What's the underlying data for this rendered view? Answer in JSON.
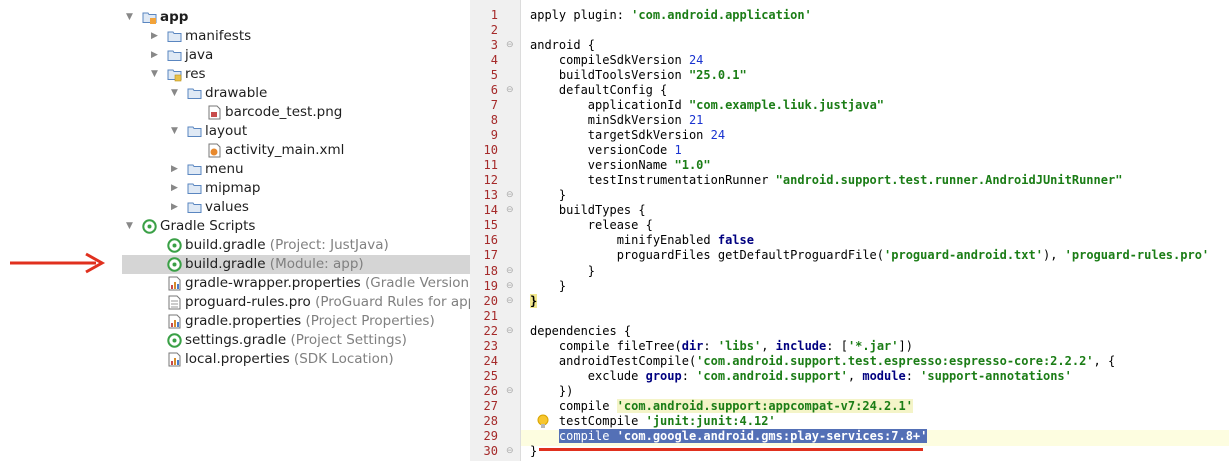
{
  "tree": [
    {
      "label": "app",
      "hint": "",
      "bold": true,
      "icon": "module-folder-icon",
      "twisty": "down",
      "indent": 0
    },
    {
      "label": "manifests",
      "hint": "",
      "icon": "folder-icon",
      "twisty": "right",
      "indent": 1
    },
    {
      "label": "java",
      "hint": "",
      "icon": "folder-icon",
      "twisty": "right",
      "indent": 1
    },
    {
      "label": "res",
      "hint": "",
      "icon": "res-folder-icon",
      "twisty": "down",
      "indent": 1
    },
    {
      "label": "drawable",
      "hint": "",
      "icon": "folder-icon",
      "twisty": "down",
      "indent": 2
    },
    {
      "label": "barcode_test.png",
      "hint": "",
      "icon": "image-file-icon",
      "twisty": "",
      "indent": 4
    },
    {
      "label": "layout",
      "hint": "",
      "icon": "folder-icon",
      "twisty": "down",
      "indent": 2
    },
    {
      "label": "activity_main.xml",
      "hint": "",
      "icon": "xml-file-icon",
      "twisty": "",
      "indent": 4
    },
    {
      "label": "menu",
      "hint": "",
      "icon": "folder-icon",
      "twisty": "right",
      "indent": 2
    },
    {
      "label": "mipmap",
      "hint": "",
      "icon": "folder-icon",
      "twisty": "right",
      "indent": 2
    },
    {
      "label": "values",
      "hint": "",
      "icon": "folder-icon",
      "twisty": "right",
      "indent": 2
    },
    {
      "label": "Gradle Scripts",
      "hint": "",
      "icon": "gradle-icon",
      "twisty": "down",
      "indent": 0
    },
    {
      "label": "build.gradle",
      "hint": " (Project: JustJava)",
      "icon": "gradle-icon",
      "twisty": "",
      "indent": 1
    },
    {
      "label": "build.gradle",
      "hint": " (Module: app)",
      "icon": "gradle-icon",
      "twisty": "",
      "indent": 1,
      "selected": true
    },
    {
      "label": "gradle-wrapper.properties",
      "hint": " (Gradle Version)",
      "icon": "properties-file-icon",
      "twisty": "",
      "indent": 1
    },
    {
      "label": "proguard-rules.pro",
      "hint": " (ProGuard Rules for app)",
      "icon": "text-file-icon",
      "twisty": "",
      "indent": 1
    },
    {
      "label": "gradle.properties",
      "hint": " (Project Properties)",
      "icon": "properties-file-icon",
      "twisty": "",
      "indent": 1
    },
    {
      "label": "settings.gradle",
      "hint": " (Project Settings)",
      "icon": "gradle-icon",
      "twisty": "",
      "indent": 1
    },
    {
      "label": "local.properties",
      "hint": " (SDK Location)",
      "icon": "properties-file-icon",
      "twisty": "",
      "indent": 1
    }
  ],
  "code": [
    [
      [
        "t",
        "apply plugin: "
      ],
      [
        "s",
        "'com.android.application'"
      ]
    ],
    [],
    [
      [
        "t",
        "android {"
      ]
    ],
    [
      [
        "t",
        "    compileSdkVersion "
      ],
      [
        "n",
        "24"
      ]
    ],
    [
      [
        "t",
        "    buildToolsVersion "
      ],
      [
        "s",
        "\"25.0.1\""
      ]
    ],
    [
      [
        "t",
        "    defaultConfig {"
      ]
    ],
    [
      [
        "t",
        "        applicationId "
      ],
      [
        "s",
        "\"com.example.liuk.justjava\""
      ]
    ],
    [
      [
        "t",
        "        minSdkVersion "
      ],
      [
        "n",
        "21"
      ]
    ],
    [
      [
        "t",
        "        targetSdkVersion "
      ],
      [
        "n",
        "24"
      ]
    ],
    [
      [
        "t",
        "        versionCode "
      ],
      [
        "n",
        "1"
      ]
    ],
    [
      [
        "t",
        "        versionName "
      ],
      [
        "s",
        "\"1.0\""
      ]
    ],
    [
      [
        "t",
        "        testInstrumentationRunner "
      ],
      [
        "s",
        "\"android.support.test.runner.AndroidJUnitRunner\""
      ]
    ],
    [
      [
        "t",
        "    }"
      ]
    ],
    [
      [
        "t",
        "    buildTypes {"
      ]
    ],
    [
      [
        "t",
        "        release {"
      ]
    ],
    [
      [
        "t",
        "            minifyEnabled "
      ],
      [
        "k",
        "false"
      ]
    ],
    [
      [
        "t",
        "            proguardFiles getDefaultProguardFile("
      ],
      [
        "s",
        "'proguard-android.txt'"
      ],
      [
        "t",
        "), "
      ],
      [
        "s",
        "'proguard-rules.pro'"
      ]
    ],
    [
      [
        "t",
        "        }"
      ]
    ],
    [
      [
        "t",
        "    }"
      ]
    ],
    [
      [
        "b",
        "}"
      ]
    ],
    [],
    [
      [
        "t",
        "dependencies {"
      ]
    ],
    [
      [
        "t",
        "    compile fileTree("
      ],
      [
        "k",
        "dir"
      ],
      [
        "t",
        ": "
      ],
      [
        "s",
        "'libs'"
      ],
      [
        "t",
        ", "
      ],
      [
        "k",
        "include"
      ],
      [
        "t",
        ": ["
      ],
      [
        "s",
        "'*.jar'"
      ],
      [
        "t",
        "])"
      ]
    ],
    [
      [
        "t",
        "    androidTestCompile("
      ],
      [
        "s",
        "'com.android.support.test.espresso:espresso-core:2.2.2'"
      ],
      [
        "t",
        ", {"
      ]
    ],
    [
      [
        "t",
        "        exclude "
      ],
      [
        "k",
        "group"
      ],
      [
        "t",
        ": "
      ],
      [
        "s",
        "'com.android.support'"
      ],
      [
        "t",
        ", "
      ],
      [
        "k",
        "module"
      ],
      [
        "t",
        ": "
      ],
      [
        "s",
        "'support-annotations'"
      ]
    ],
    [
      [
        "t",
        "    })"
      ]
    ],
    [
      [
        "t",
        "    compile "
      ],
      [
        "h",
        "'com.android.support:appcompat-v7:24.2.1'"
      ]
    ],
    [
      [
        "t",
        "    testCompile "
      ],
      [
        "s",
        "'junit:junit:4.12'"
      ]
    ],
    [
      [
        "t",
        "    "
      ],
      [
        "x",
        "compile 'com.google.android.gms:play-services:7.8+'"
      ]
    ],
    [
      [
        "t",
        "}"
      ]
    ]
  ],
  "line_numbers": [
    "1",
    "2",
    "3",
    "4",
    "5",
    "6",
    "7",
    "8",
    "9",
    "10",
    "11",
    "12",
    "13",
    "14",
    "15",
    "16",
    "17",
    "18",
    "19",
    "20",
    "21",
    "22",
    "23",
    "24",
    "25",
    "26",
    "27",
    "28",
    "29",
    "30"
  ],
  "colors": {
    "accent_arrow": "#e0301e",
    "selection": "#5470b6",
    "string": "#1b7d16",
    "number": "#1a34d0"
  }
}
